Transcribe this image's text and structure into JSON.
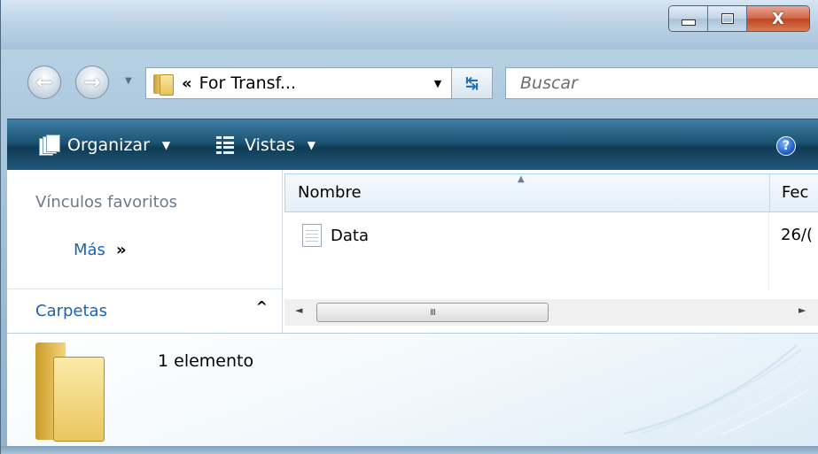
{
  "window": {
    "close_glyph": "X"
  },
  "navigation": {
    "back_glyph": "←",
    "forward_glyph": "→"
  },
  "address": {
    "separator": "«",
    "path": "For Transf...",
    "refresh_glyph": "↹"
  },
  "search": {
    "placeholder": "Buscar"
  },
  "toolbar": {
    "organize_label": "Organizar",
    "views_label": "Vistas",
    "help_glyph": "?"
  },
  "nav_pane": {
    "favorites_title": "Vínculos favoritos",
    "more_link": "Más",
    "more_chevron": "»",
    "folders_label": "Carpetas",
    "folders_toggle": "^"
  },
  "file_list": {
    "columns": [
      "Nombre",
      "Fec"
    ],
    "rows": [
      {
        "name": "Data",
        "date": "26/("
      }
    ]
  },
  "scrollbar": {
    "left_arrow": "◄",
    "right_arrow": "►",
    "thumb_grip": "III"
  },
  "details": {
    "count": "1 elemento"
  },
  "colors": {
    "toolbar": "#1c5373",
    "link": "#1b63b6",
    "close_button": "#c0451f"
  }
}
